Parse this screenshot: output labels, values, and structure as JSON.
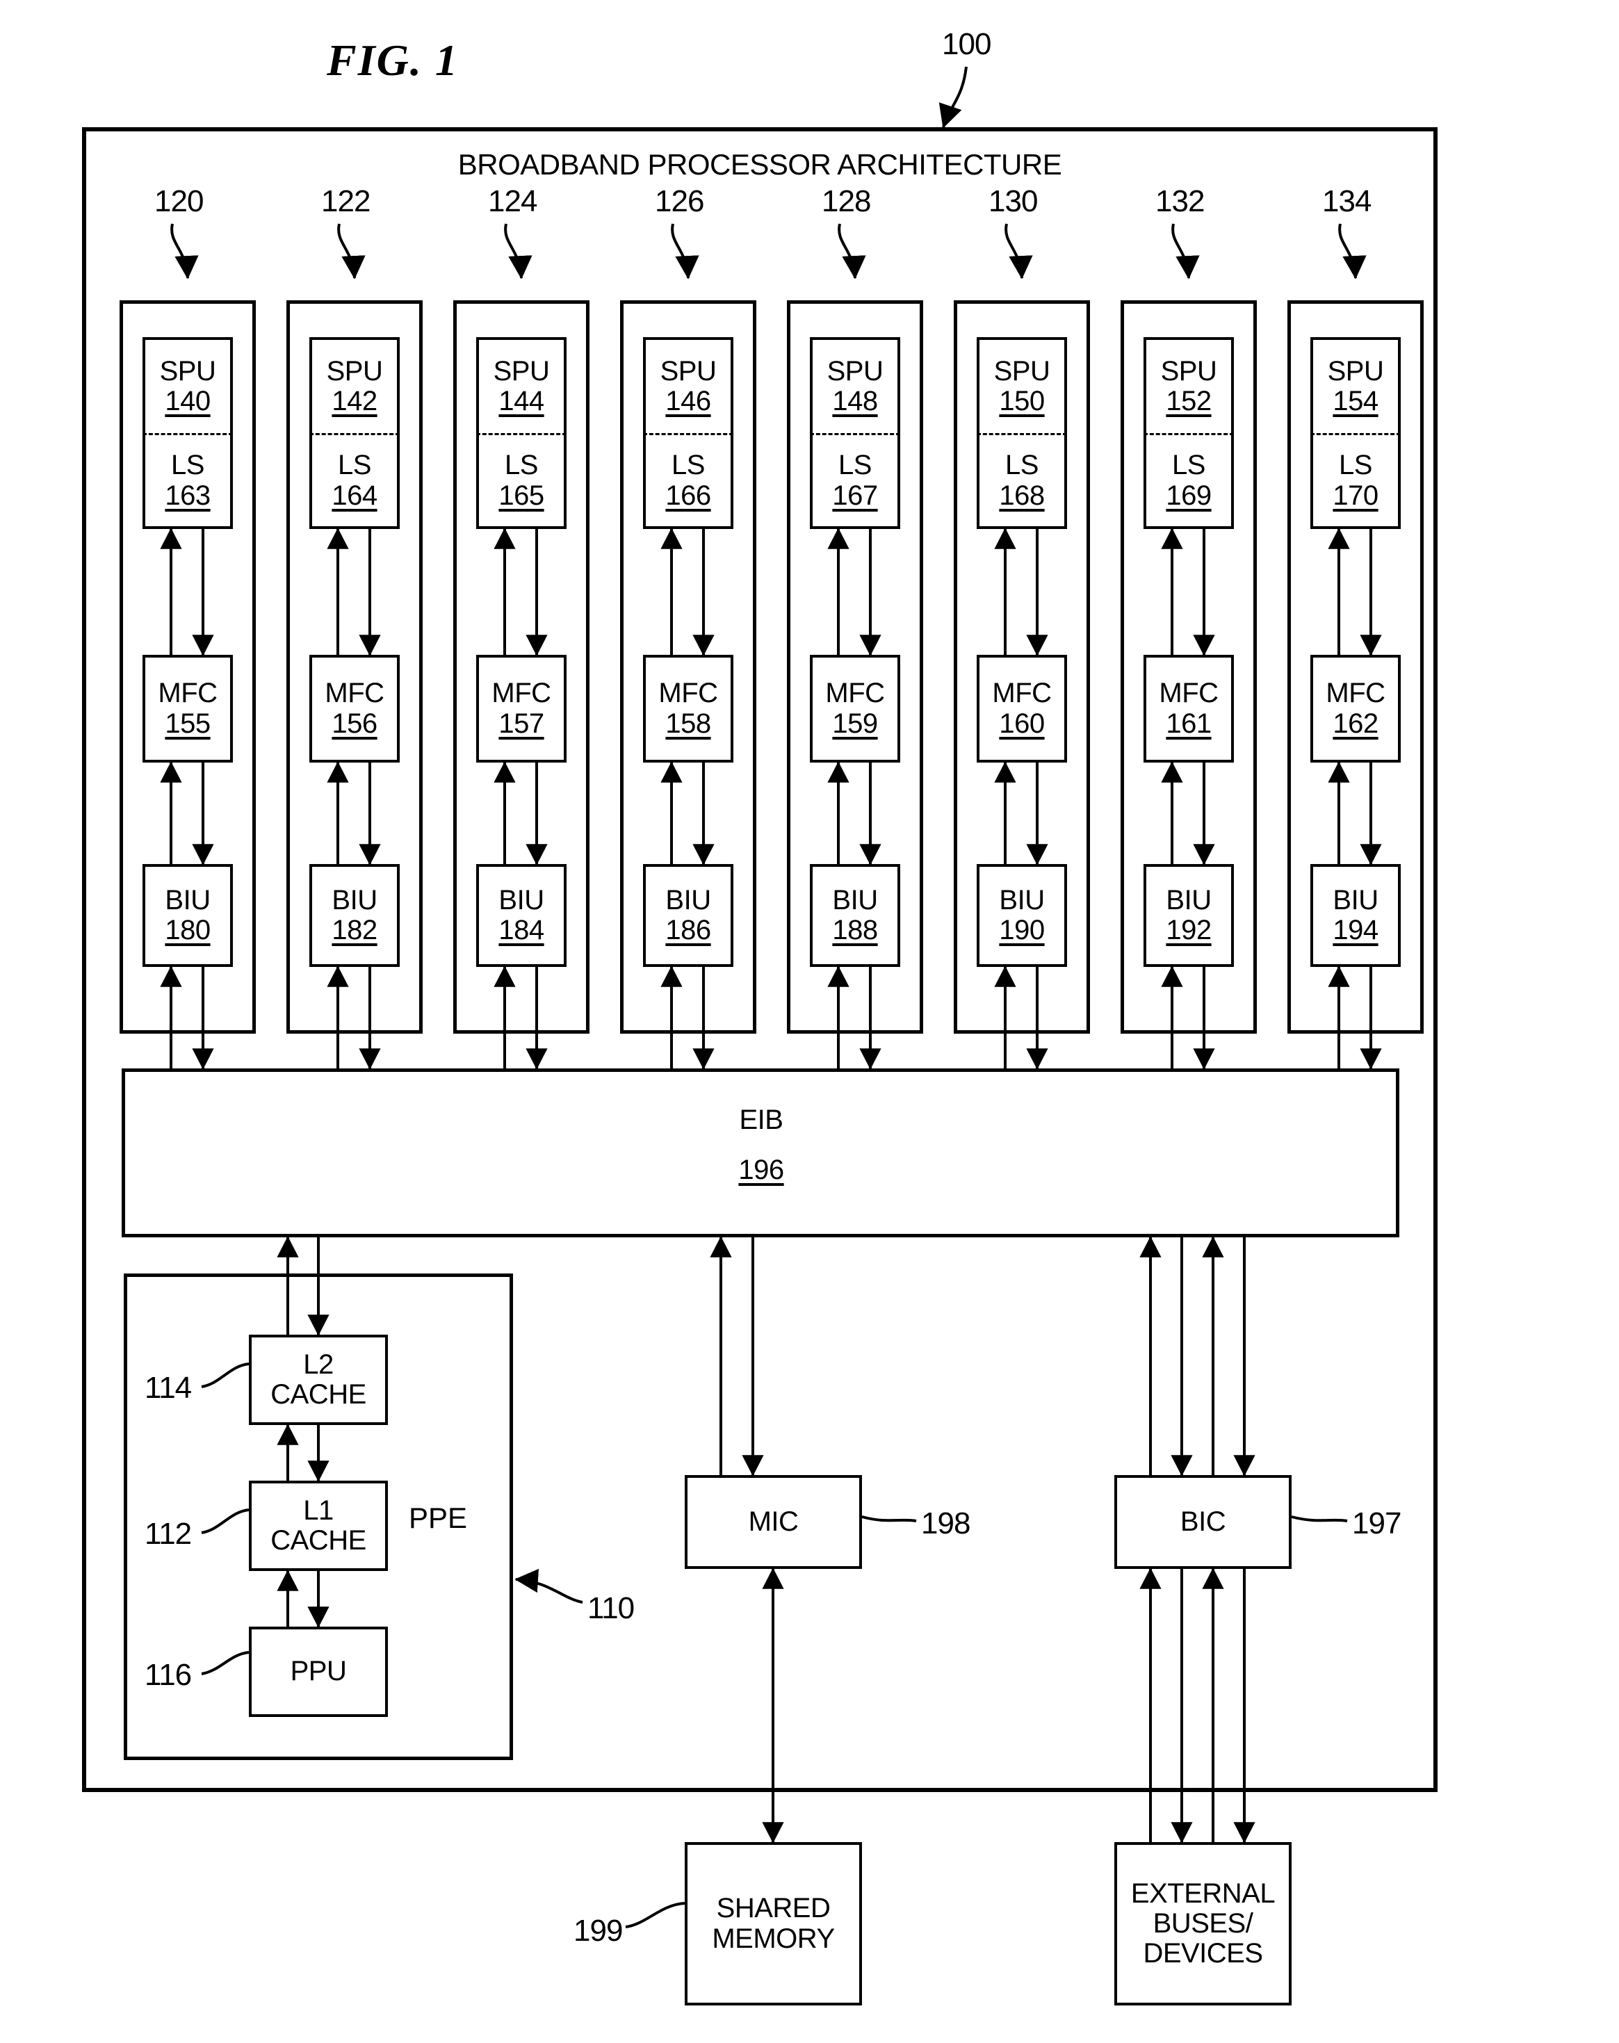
{
  "figure": {
    "title": "FIG. 1",
    "root_ref": "100",
    "architecture_title": "BROADBAND PROCESSOR ARCHITECTURE"
  },
  "spes": [
    {
      "ref": "120",
      "spu_label": "SPU",
      "spu_num": "140",
      "ls_label": "LS",
      "ls_num": "163",
      "mfc_label": "MFC",
      "mfc_num": "155",
      "biu_label": "BIU",
      "biu_num": "180"
    },
    {
      "ref": "122",
      "spu_label": "SPU",
      "spu_num": "142",
      "ls_label": "LS",
      "ls_num": "164",
      "mfc_label": "MFC",
      "mfc_num": "156",
      "biu_label": "BIU",
      "biu_num": "182"
    },
    {
      "ref": "124",
      "spu_label": "SPU",
      "spu_num": "144",
      "ls_label": "LS",
      "ls_num": "165",
      "mfc_label": "MFC",
      "mfc_num": "157",
      "biu_label": "BIU",
      "biu_num": "184"
    },
    {
      "ref": "126",
      "spu_label": "SPU",
      "spu_num": "146",
      "ls_label": "LS",
      "ls_num": "166",
      "mfc_label": "MFC",
      "mfc_num": "158",
      "biu_label": "BIU",
      "biu_num": "186"
    },
    {
      "ref": "128",
      "spu_label": "SPU",
      "spu_num": "148",
      "ls_label": "LS",
      "ls_num": "167",
      "mfc_label": "MFC",
      "mfc_num": "159",
      "biu_label": "BIU",
      "biu_num": "188"
    },
    {
      "ref": "130",
      "spu_label": "SPU",
      "spu_num": "150",
      "ls_label": "LS",
      "ls_num": "168",
      "mfc_label": "MFC",
      "mfc_num": "160",
      "biu_label": "BIU",
      "biu_num": "190"
    },
    {
      "ref": "132",
      "spu_label": "SPU",
      "spu_num": "152",
      "ls_label": "LS",
      "ls_num": "169",
      "mfc_label": "MFC",
      "mfc_num": "161",
      "biu_label": "BIU",
      "biu_num": "192"
    },
    {
      "ref": "134",
      "spu_label": "SPU",
      "spu_num": "154",
      "ls_label": "LS",
      "ls_num": "170",
      "mfc_label": "MFC",
      "mfc_num": "162",
      "biu_label": "BIU",
      "biu_num": "194"
    }
  ],
  "eib": {
    "label": "EIB",
    "num": "196"
  },
  "ppe": {
    "tag": "PPE",
    "ref": "110",
    "l2": {
      "line1": "L2",
      "line2": "CACHE",
      "ref": "114"
    },
    "l1": {
      "line1": "L1",
      "line2": "CACHE",
      "ref": "112"
    },
    "ppu": {
      "label": "PPU",
      "ref": "116"
    }
  },
  "mic": {
    "label": "MIC",
    "ref": "198"
  },
  "bic": {
    "label": "BIC",
    "ref": "197"
  },
  "shared_memory": {
    "line1": "SHARED",
    "line2": "MEMORY",
    "ref": "199"
  },
  "external": {
    "line1": "EXTERNAL",
    "line2": "BUSES/",
    "line3": "DEVICES"
  },
  "colors": {
    "ink": "#000000",
    "paper": "#ffffff"
  }
}
